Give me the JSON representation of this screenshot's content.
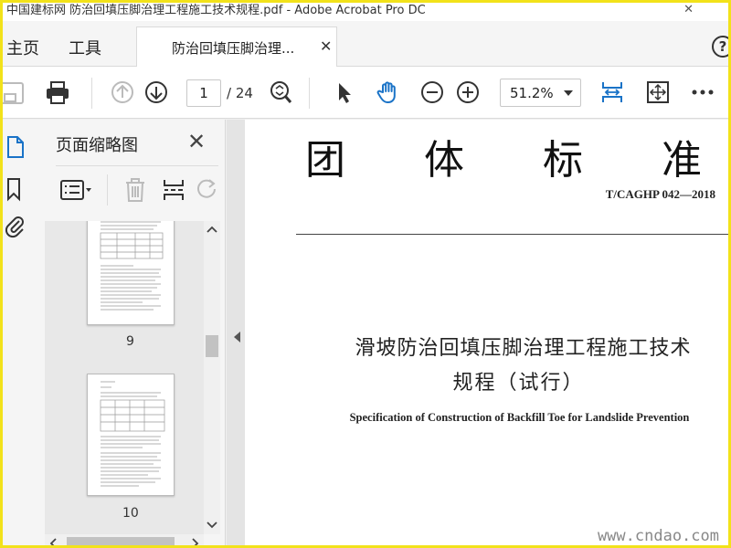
{
  "window": {
    "title": "中国建标网 防治回填压脚治理工程施工技术规程.pdf - Adobe Acrobat Pro DC",
    "watermark_top": "中国建标网",
    "close_glyph": "✕"
  },
  "tabs": {
    "home": "主页",
    "tools": "工具",
    "document": "防治回填压脚治理...",
    "document_close": "✕"
  },
  "toolbar": {
    "current_page": "1",
    "total_pages": "/ 24",
    "zoom": "51.2%"
  },
  "thumbnails_panel": {
    "heading": "页面缩略图",
    "close_glyph": "✕",
    "pages": [
      {
        "number": "9"
      },
      {
        "number": "10"
      }
    ]
  },
  "document": {
    "standard_heading": "团体标准",
    "standard_code": "T/CAGHP 042—2018",
    "title_cn_line1": "滑坡防治回填压脚治理工程施工技术",
    "title_cn_line2": "规程（试行）",
    "title_en": "Specification of Construction of Backfill Toe for Landslide Prevention"
  },
  "watermark_bottom": "www.cndao.com",
  "colors": {
    "frame_border": "#f2e21a",
    "accent_blue": "#1a73c7"
  }
}
